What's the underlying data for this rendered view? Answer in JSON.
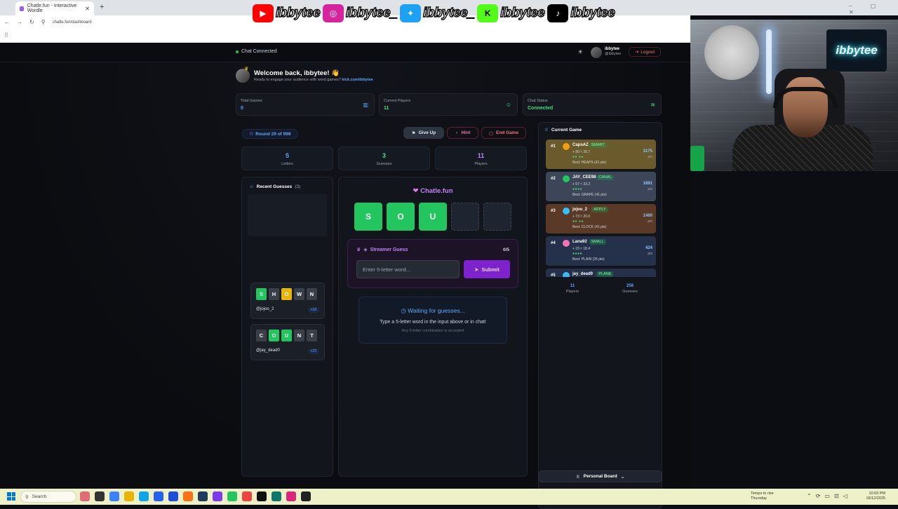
{
  "browser": {
    "tab_title": "Chatle.fun - Interactive Wordle",
    "url": "chatle.fun/dashboard",
    "new_tab": "+",
    "close": "✕"
  },
  "social_banner": [
    {
      "platform": "youtube",
      "icon": "youtube-icon",
      "color": "#ff0000",
      "handle": "ibbytee"
    },
    {
      "platform": "instagram",
      "icon": "instagram-icon",
      "color": "#d6249f",
      "handle": "ibbytee_"
    },
    {
      "platform": "twitter",
      "icon": "twitter-icon",
      "color": "#1da1f2",
      "handle": "ibbytee_"
    },
    {
      "platform": "kick",
      "icon": "kick-icon",
      "color": "#53fc18",
      "handle": "ibbytee"
    },
    {
      "platform": "tiktok",
      "icon": "tiktok-icon",
      "color": "#000000",
      "handle": "ibbytee"
    }
  ],
  "header": {
    "chat_status": "Chat Connected",
    "user_name": "ibbytee",
    "user_handle": "@ibbytee",
    "logout_label": "Logout"
  },
  "welcome": {
    "title": "Welcome back, ibbytee! 👋",
    "subtitle": "Ready to engage your audience with word games?",
    "link": "kick.com/ibbytee"
  },
  "stats": {
    "total_games_label": "Total Games",
    "total_games_value": "0",
    "current_players_label": "Current Players",
    "current_players_value": "11",
    "chat_status_label": "Chat Status",
    "chat_status_value": "Connected"
  },
  "game": {
    "round_label": "Round 29 of 999",
    "give_up_label": "Give Up",
    "hint_label": "Hint",
    "end_game_label": "End Game",
    "letters_value": "5",
    "letters_label": "Letters",
    "guesses_value": "3",
    "guesses_label": "Guesses",
    "players_value": "11",
    "players_label": "Players"
  },
  "recent_guesses": {
    "title": "Recent Guesses",
    "count": "(3)",
    "items": [
      {
        "letters": [
          "S",
          "H",
          "O",
          "W",
          "N"
        ],
        "states": [
          "green",
          "gray",
          "yellow",
          "gray",
          "gray"
        ],
        "user": "@jojoo_2",
        "points": "+18"
      },
      {
        "letters": [
          "C",
          "O",
          "U",
          "N",
          "T"
        ],
        "states": [
          "gray",
          "green",
          "green",
          "gray",
          "gray"
        ],
        "user": "@jay_dead0",
        "points": "+23"
      }
    ]
  },
  "board": {
    "title": "Chatle.fun",
    "tiles": [
      "S",
      "O",
      "U",
      "",
      ""
    ],
    "streamer_guess_title": "Streamer Guess",
    "streamer_guess_count": "0/5",
    "input_placeholder": "Enter 5-letter word...",
    "submit_label": "Submit",
    "waiting_title": "Waiting for guesses...",
    "waiting_sub": "Type a 5-letter word in the input above or in chat!",
    "waiting_note": "Any 5-letter combination is accepted"
  },
  "current_game": {
    "title": "Current Game",
    "players": [
      {
        "rank": "#1",
        "name": "CapsAZ",
        "word": "SMART",
        "stats": "+ 80 ≈ 39.7",
        "dots": "●● ●●",
        "best": "Best: HEAPS (41 pts)",
        "points": "3175",
        "unit": "pts",
        "bg": "#6b5a2b"
      },
      {
        "rank": "#2",
        "name": "JAY_CEE98",
        "word": "CANAL",
        "stats": "+ 57 ≈ 33.2",
        "dots": "●●●●",
        "best": "Best: GRAPE (41 pts)",
        "points": "1891",
        "unit": "pts",
        "bg": "#3d4658"
      },
      {
        "rank": "#3",
        "name": "jojoo_2",
        "word": "APPLY",
        "stats": "+ 73 ≈ 20.0",
        "dots": "●● ●●",
        "best": "Best: CLOCK (41 pts)",
        "points": "1460",
        "unit": "pts",
        "bg": "#5a3a26"
      },
      {
        "rank": "#4",
        "name": "Lana92",
        "word": "SMALL",
        "stats": "+ 23 ≈ 18.4",
        "dots": "●●●●",
        "best": "Best: PLAIN (26 pts)",
        "points": "424",
        "unit": "pts",
        "bg": "#25314a"
      },
      {
        "rank": "#5",
        "name": "jay_dead0",
        "word": "PLANE",
        "stats": "",
        "dots": "",
        "best": "",
        "points": "",
        "unit": "",
        "bg": "#25314a"
      }
    ],
    "footer_players_value": "11",
    "footer_players_label": "Players",
    "footer_guesses_value": "258",
    "footer_guesses_label": "Guesses"
  },
  "personal_board_label": "Personal Board",
  "webcam": {
    "sign_text": "ibbytee"
  },
  "taskbar": {
    "search_placeholder": "Search",
    "weather_title": "Temps to rise",
    "weather_sub": "Thursday",
    "time": "10:03 PM",
    "date": "16/12/2025"
  },
  "colors": {
    "green": "#22c55e",
    "yellow": "#eab308",
    "gray": "#3a3f4a",
    "accent_purple": "#c084fc",
    "accent_blue": "#60a5fa"
  }
}
